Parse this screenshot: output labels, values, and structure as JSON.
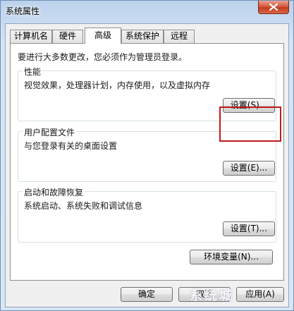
{
  "window": {
    "title": "系统属性"
  },
  "tabs": [
    {
      "label": "计算机名"
    },
    {
      "label": "硬件"
    },
    {
      "label": "高级"
    },
    {
      "label": "系统保护"
    },
    {
      "label": "远程"
    }
  ],
  "active_tab": "高级",
  "panel": {
    "notice": "要进行大多数更改，您必须作为管理员登录。",
    "performance": {
      "title": "性能",
      "desc": "视觉效果，处理器计划，内存使用，以及虚拟内存",
      "button": "设置(S)..."
    },
    "user_profiles": {
      "title": "用户配置文件",
      "desc": "与您登录有关的桌面设置",
      "button": "设置(E)..."
    },
    "startup_recovery": {
      "title": "启动和故障恢复",
      "desc": "系统启动、系统失败和调试信息",
      "button": "设置(T)..."
    },
    "env_button": "环境变量(N)..."
  },
  "footer": {
    "ok": "确定",
    "cancel": "取消",
    "apply": "应用(A)"
  },
  "watermark": "系统城",
  "colors": {
    "highlight": "#c0191a",
    "close_button": "#c33d20"
  }
}
